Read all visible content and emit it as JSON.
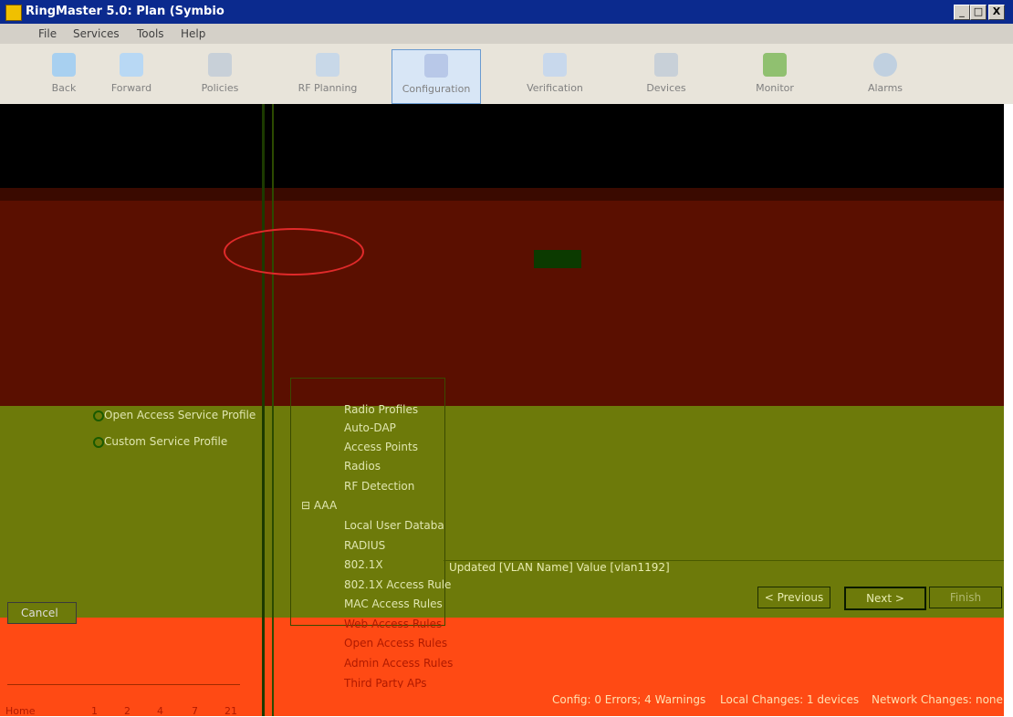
{
  "window": {
    "title": "RingMaster 5.0: Plan (Symbio",
    "minimize": "_",
    "maximize": "□",
    "close": "X"
  },
  "menu": {
    "items": [
      "File",
      "Services",
      "Tools",
      "Help"
    ]
  },
  "toolbar": {
    "buttons": [
      {
        "label": "Back",
        "icon": "back-arrow-icon"
      },
      {
        "label": "Forward",
        "icon": "forward-arrow-icon"
      },
      {
        "label": "Policies",
        "icon": "policies-icon"
      },
      {
        "label": "RF Planning",
        "icon": "rf-planning-icon"
      },
      {
        "label": "Configuration",
        "icon": "configuration-icon"
      },
      {
        "label": "Verification",
        "icon": "verification-icon"
      },
      {
        "label": "Devices",
        "icon": "devices-icon"
      },
      {
        "label": "Monitor",
        "icon": "monitor-icon"
      },
      {
        "label": "Alarms",
        "icon": "alarms-icon"
      }
    ]
  },
  "service_profiles": {
    "open_access": "Open Access Service Profile",
    "custom": "Custom Service Profile"
  },
  "tree": {
    "items_a": [
      "Radio Profiles",
      "Auto-DAP",
      "Access Points",
      "Radios",
      "RF Detection"
    ],
    "aaa_node": "AAA",
    "items_b": [
      "Local User Databa",
      "RADIUS",
      "802.1X",
      "802.1X Access Rule",
      "MAC Access Rules",
      "Web Access Rules",
      "Open Access Rules",
      "Admin Access Rules",
      "Third Party APs"
    ]
  },
  "status_message": "Updated [VLAN Name] Value [vlan1192]",
  "buttons": {
    "previous": "< Previous",
    "next": "Next >",
    "finish": "Finish",
    "cancel": "Cancel"
  },
  "bottom_tabs": [
    "Home",
    "1",
    "2",
    "4",
    "7",
    "21"
  ],
  "statusbar": {
    "config": "Config: 0 Errors; 4 Warnings",
    "local": "Local Changes: 1 devices",
    "network": "Network Changes: none"
  },
  "colors": {
    "titlebar": "#0b2a8e",
    "maroon_band": "#5a0f00",
    "olive_band": "#6d7a0a",
    "orange_band": "#ff4a14",
    "highlight": "#e02a2a"
  }
}
